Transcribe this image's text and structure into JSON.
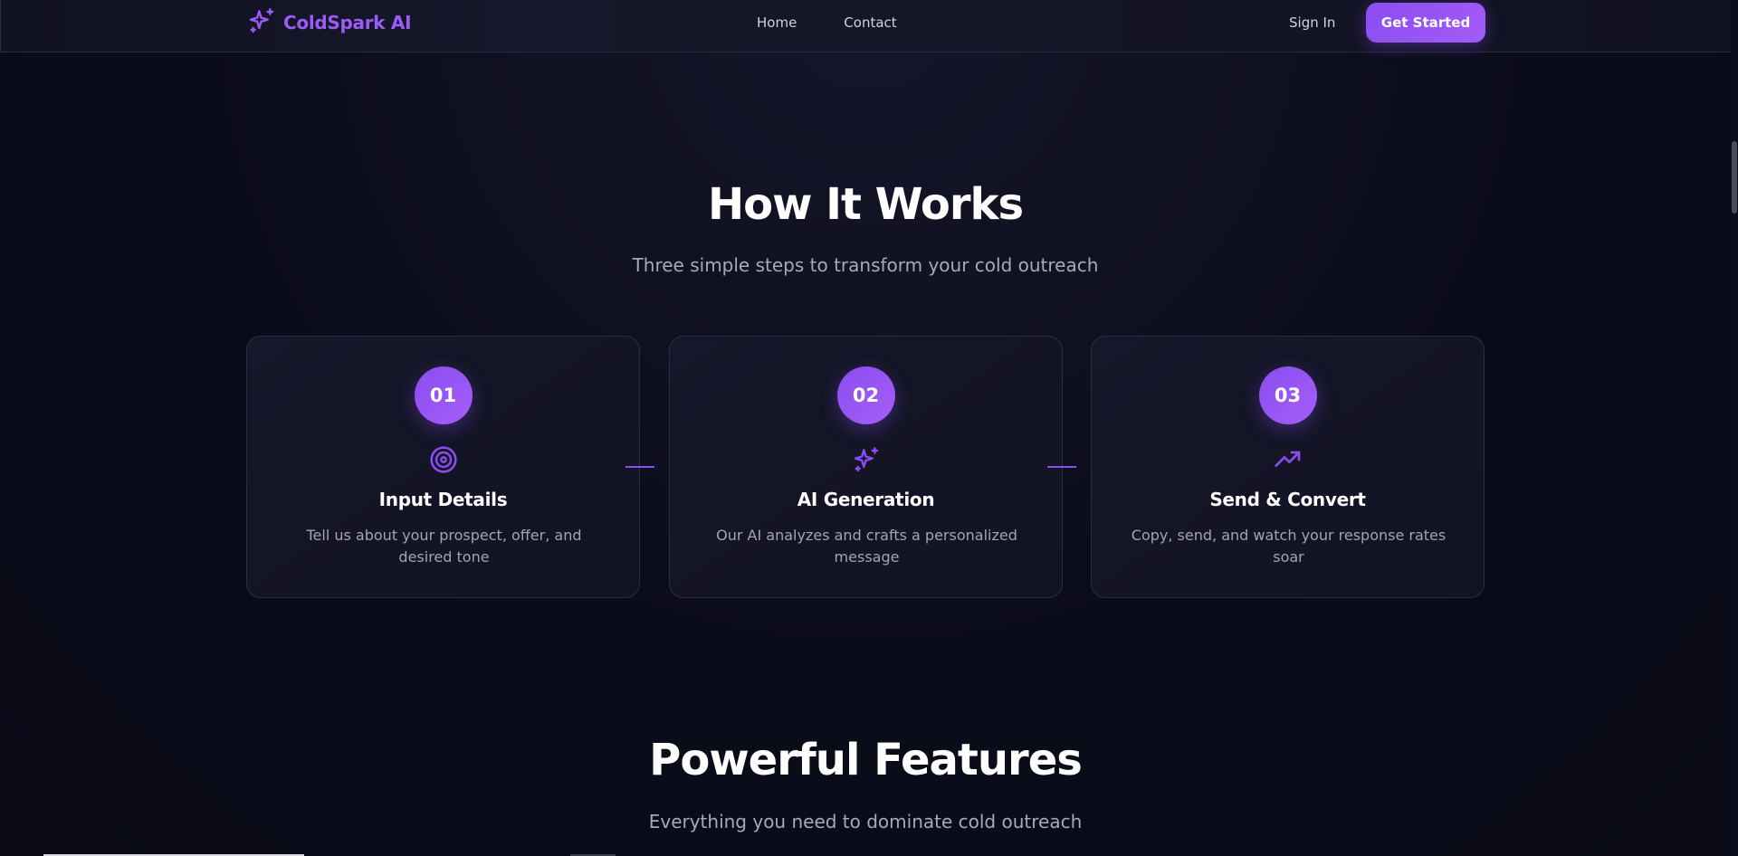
{
  "brand": {
    "name": "ColdSpark AI",
    "icon": "sparkles-icon",
    "accent_color": "#9b5cf6"
  },
  "nav": {
    "links": [
      "Home",
      "Contact"
    ],
    "signin_label": "Sign In",
    "cta_label": "Get Started"
  },
  "how_it_works": {
    "title": "How It Works",
    "subtitle": "Three simple steps to transform your cold outreach",
    "steps": [
      {
        "number": "01",
        "icon": "target-icon",
        "title": "Input Details",
        "description": "Tell us about your prospect, offer, and desired tone"
      },
      {
        "number": "02",
        "icon": "sparkles-icon",
        "title": "AI Generation",
        "description": "Our AI analyzes and crafts a personalized message"
      },
      {
        "number": "03",
        "icon": "trending-up-icon",
        "title": "Send & Convert",
        "description": "Copy, send, and watch your response rates soar"
      }
    ]
  },
  "features": {
    "title": "Powerful Features",
    "subtitle": "Everything you need to dominate cold outreach"
  },
  "colors": {
    "background": "#0b0c1a",
    "card_background": "#15162a",
    "purple_gradient_start": "#8a4cf0",
    "purple_gradient_end": "#a65ff8",
    "muted_text": "#a8a9b9"
  }
}
